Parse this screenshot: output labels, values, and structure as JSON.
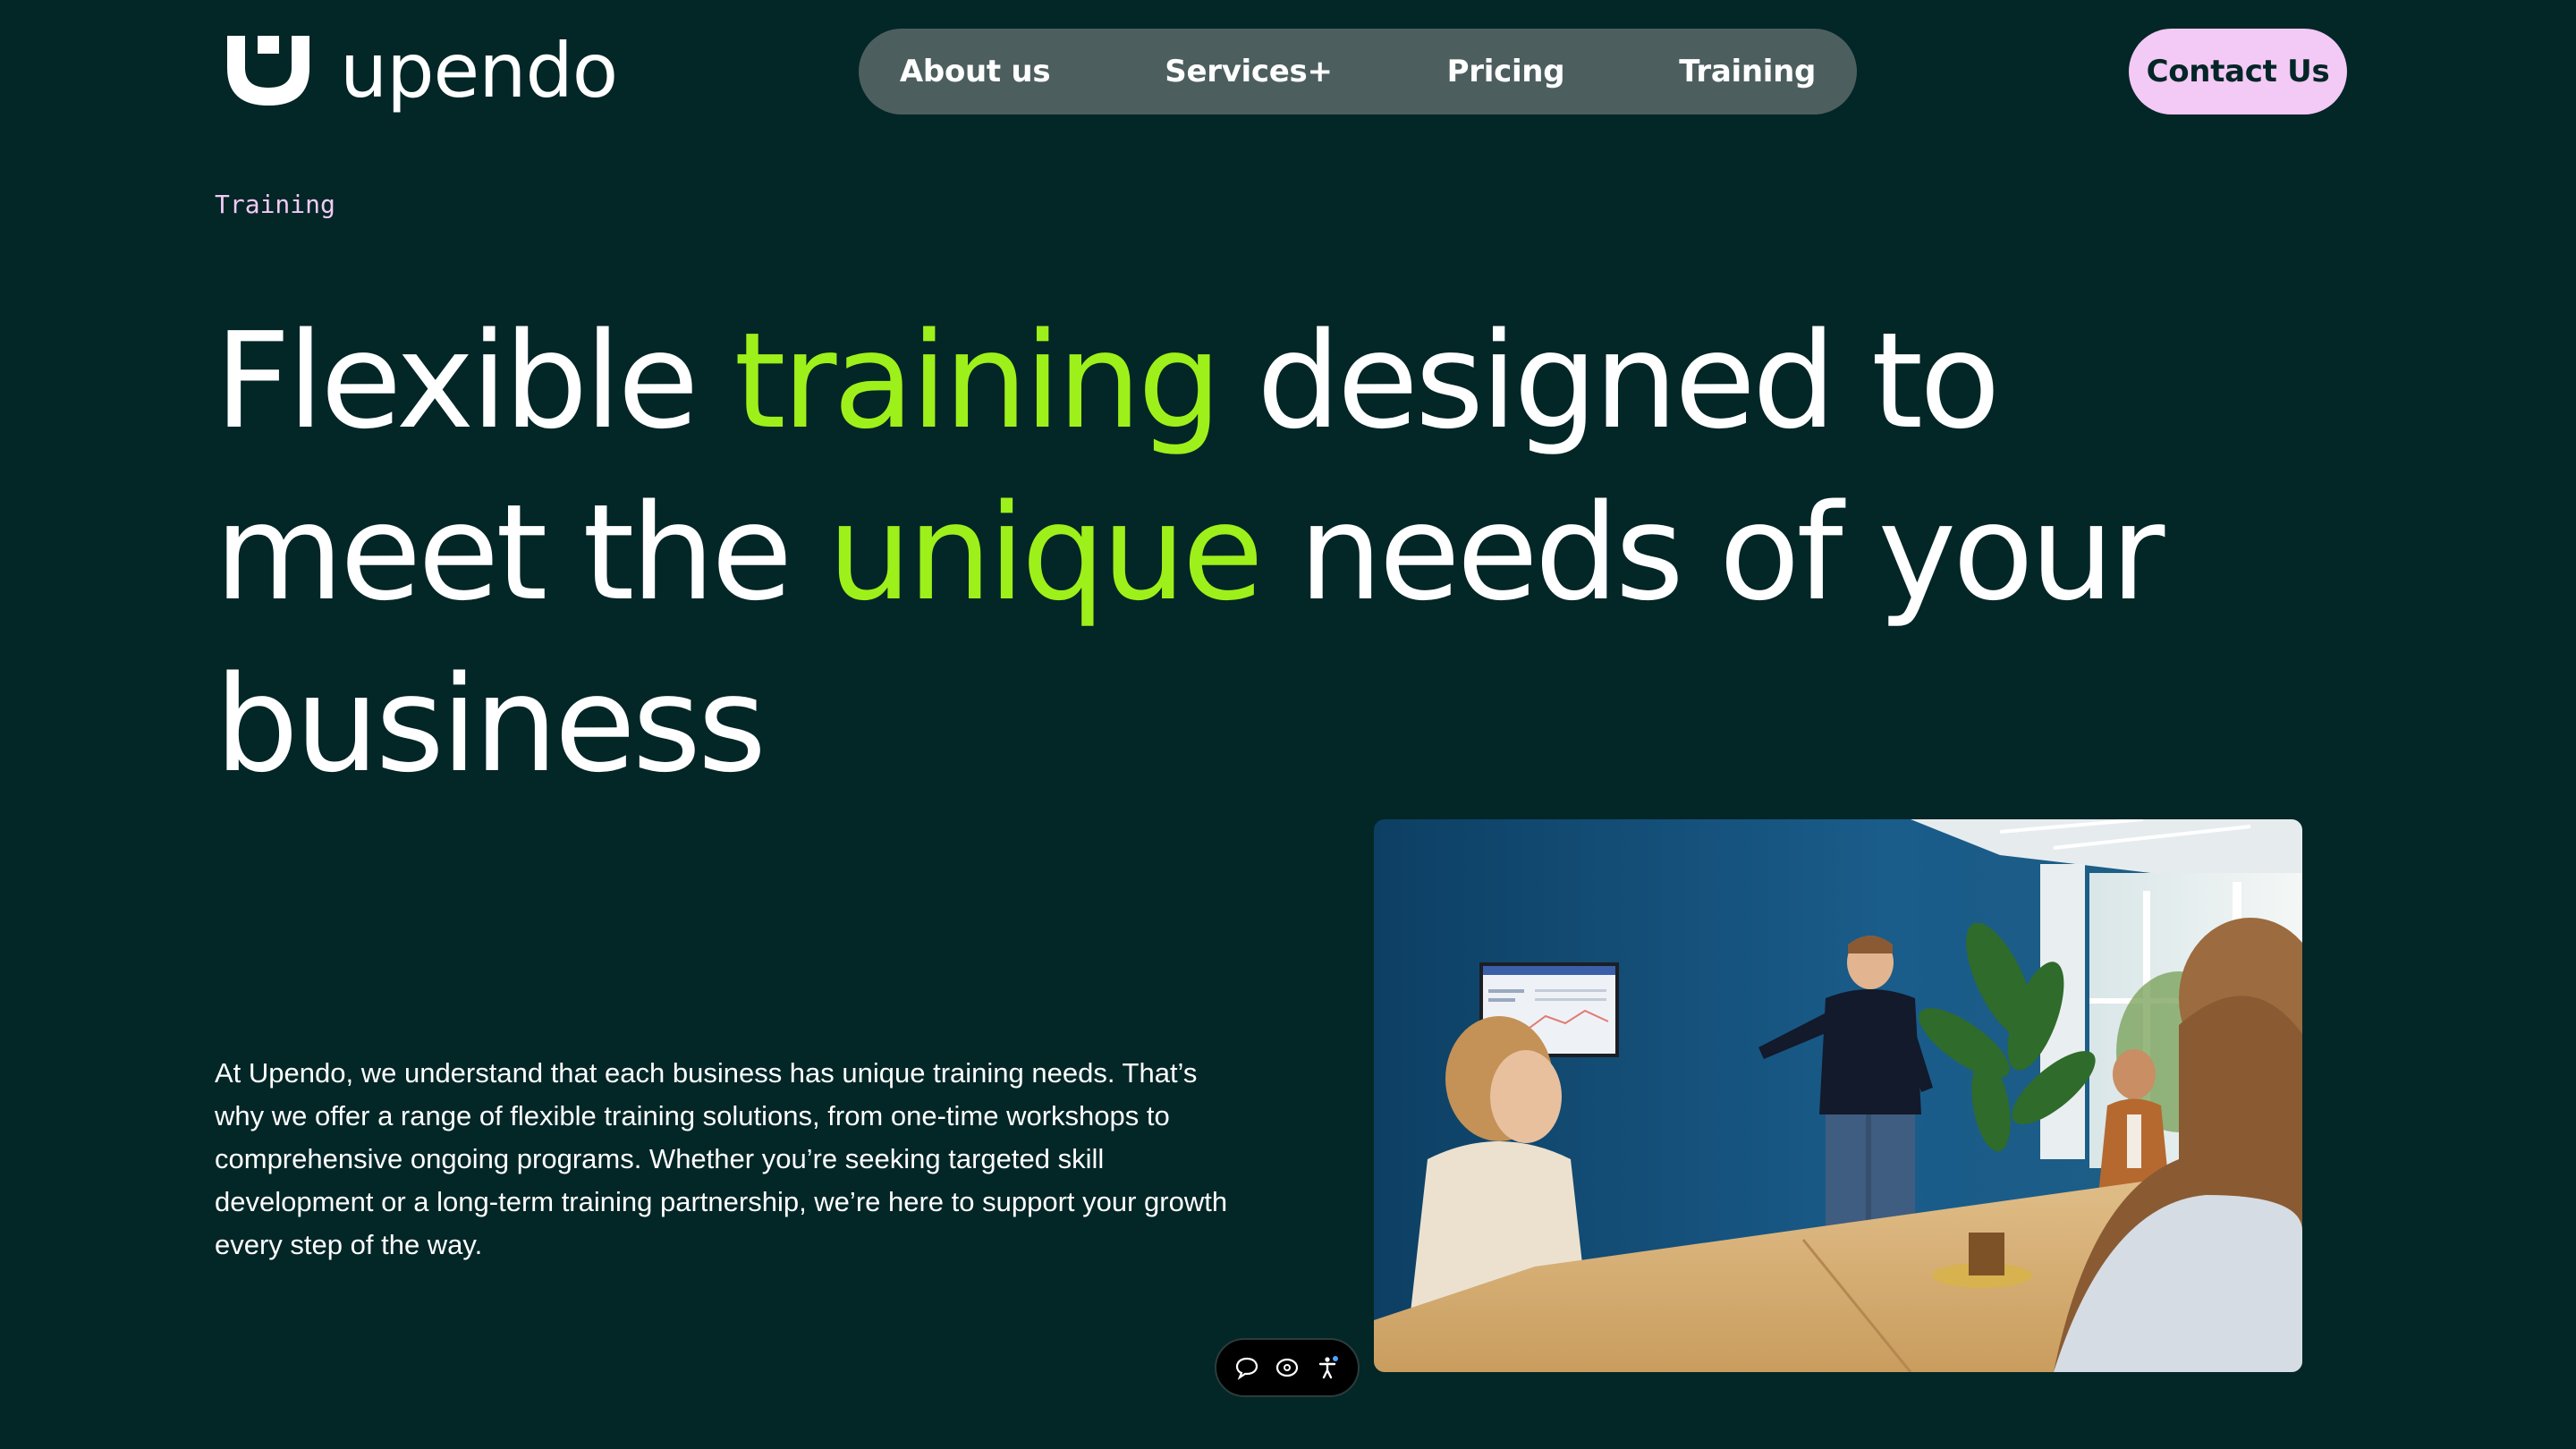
{
  "brand": {
    "name": "upendo"
  },
  "nav": {
    "items": [
      {
        "label": "About us"
      },
      {
        "label": "Services+"
      },
      {
        "label": "Pricing"
      },
      {
        "label": "Training"
      }
    ]
  },
  "cta": {
    "label": "Contact Us"
  },
  "hero": {
    "eyebrow": "Training",
    "headline": {
      "part1": "Flexible ",
      "highlight1": "training",
      "part2": " designed to meet the ",
      "highlight2": "unique",
      "part3": " needs of your business"
    },
    "body": "At Upendo, we understand that each business has unique training needs. That’s why we offer a range of flexible training solutions, from one-time workshops to comprehensive ongoing programs. Whether you’re seeking targeted skill development or a long-term training partnership, we’re here to support your growth every step of the way."
  },
  "widget": {
    "icons": [
      "chat-icon",
      "cookie-icon",
      "accessibility-icon"
    ]
  },
  "colors": {
    "background": "#032627",
    "accent_green": "#9ef01a",
    "accent_pink": "#f3c9f5",
    "nav_pill": "#4c5f5e"
  }
}
